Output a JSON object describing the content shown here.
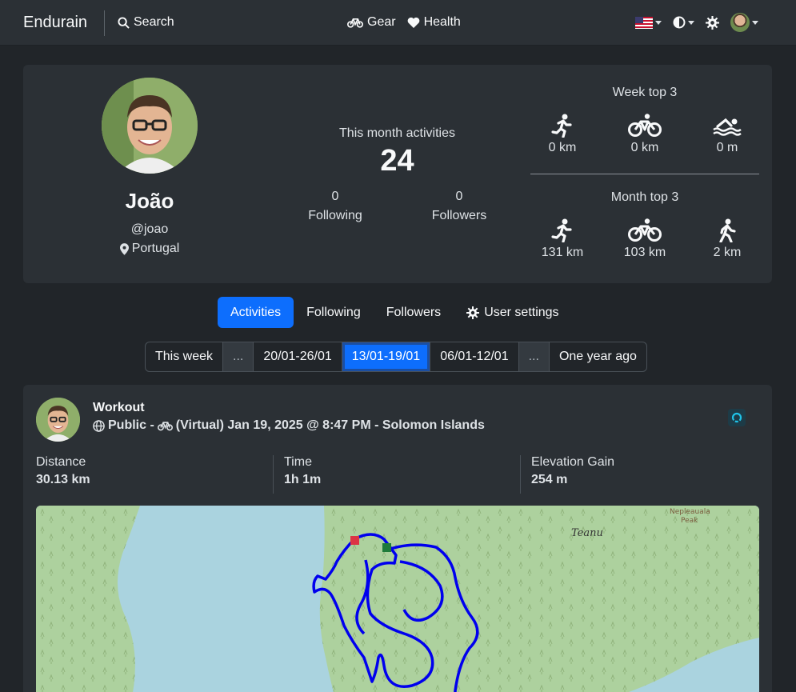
{
  "navbar": {
    "brand": "Endurain",
    "search_label": "Search",
    "gear_label": "Gear",
    "health_label": "Health"
  },
  "profile": {
    "name": "João",
    "handle": "@joao",
    "location": "Portugal",
    "month_label": "This month activities",
    "month_count": "24",
    "following_count": "0",
    "following_label": "Following",
    "followers_count": "0",
    "followers_label": "Followers"
  },
  "week_top": {
    "title": "Week top 3",
    "items": [
      {
        "icon": "run-icon",
        "value": "0 km"
      },
      {
        "icon": "bike-icon",
        "value": "0 km"
      },
      {
        "icon": "swim-icon",
        "value": "0 m"
      }
    ]
  },
  "month_top": {
    "title": "Month top 3",
    "items": [
      {
        "icon": "run-icon",
        "value": "131 km"
      },
      {
        "icon": "bike-icon",
        "value": "103 km"
      },
      {
        "icon": "walk-icon",
        "value": "2 km"
      }
    ]
  },
  "tabs": [
    {
      "label": "Activities",
      "active": true
    },
    {
      "label": "Following",
      "active": false
    },
    {
      "label": "Followers",
      "active": false
    },
    {
      "label": "User settings",
      "active": false
    }
  ],
  "pager": [
    {
      "label": "This week"
    },
    {
      "label": "..."
    },
    {
      "label": "20/01-26/01"
    },
    {
      "label": "13/01-19/01",
      "active": true
    },
    {
      "label": "06/01-12/01"
    },
    {
      "label": "..."
    },
    {
      "label": "One year ago"
    }
  ],
  "activity": {
    "title": "Workout",
    "visibility": "Public -",
    "details": "(Virtual) Jan 19, 2025 @ 8:47 PM - Solomon Islands",
    "metrics": [
      {
        "label": "Distance",
        "value": "30.13 km"
      },
      {
        "label": "Time",
        "value": "1h 1m"
      },
      {
        "label": "Elevation Gain",
        "value": "254 m"
      }
    ],
    "map_labels": {
      "town": "Teanu",
      "peak_line1": "Nepleauala",
      "peak_line2": "Peak"
    }
  },
  "colors": {
    "accent": "#0d6efd",
    "route": "#0000ee",
    "start_marker": "#1e7b3a",
    "end_marker": "#dc3545"
  }
}
